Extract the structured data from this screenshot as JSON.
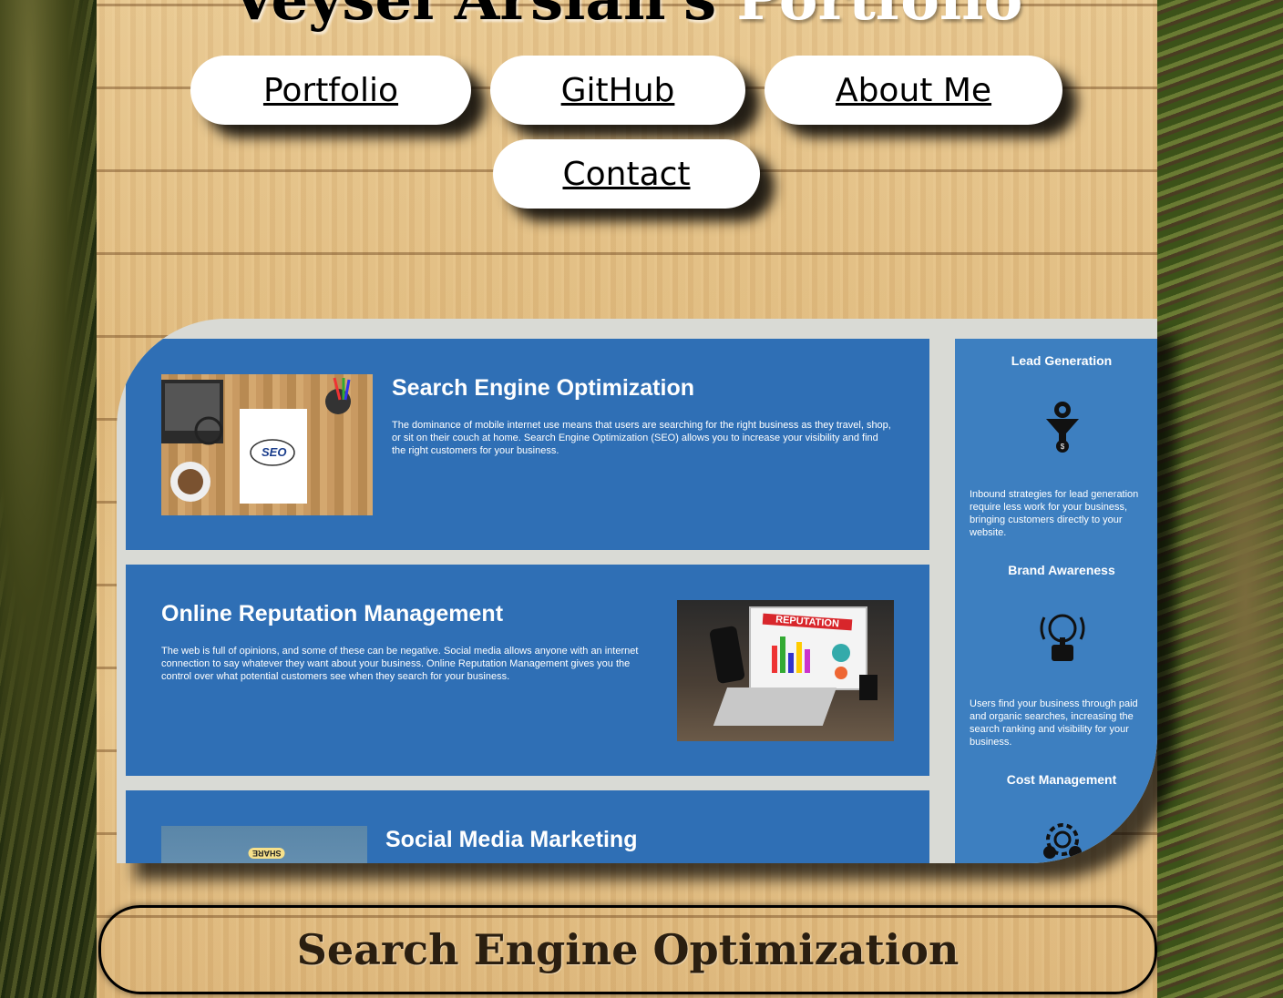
{
  "header": {
    "title_main": "Veysel Arslan's",
    "title_accent": "Portfolio"
  },
  "nav": {
    "portfolio": "Portfolio",
    "github": "GitHub",
    "about": "About Me",
    "contact": "Contact"
  },
  "preview": {
    "cards": [
      {
        "title": "Search Engine Optimization",
        "text": "The dominance of mobile internet use means that users are searching for the right business as they travel, shop, or sit on their couch at home. Search Engine Optimization (SEO) allows you to increase your visibility and find the right customers for your business.",
        "image_label": "SEO"
      },
      {
        "title": "Online Reputation Management",
        "text": "The web is full of opinions, and some of these can be negative. Social media allows anyone with an internet connection to say whatever they want about your business. Online Reputation Management gives you the control over what potential customers see when they search for your business.",
        "image_label": "REPUTATION"
      },
      {
        "title": "Social Media Marketing",
        "image_label": "SHARE"
      }
    ],
    "benefits": [
      {
        "title": "Lead Generation",
        "text": "Inbound strategies for lead generation require less work for your business, bringing customers directly to your website.",
        "icon": "funnel-gear-icon"
      },
      {
        "title": "Brand Awareness",
        "text": "Users find your business through paid and organic searches, increasing the search ranking and visibility for your business.",
        "icon": "lightbulb-person-icon"
      },
      {
        "title": "Cost Management",
        "icon": "gears-icon"
      }
    ]
  },
  "section": {
    "title": "Search Engine Optimization"
  },
  "colors": {
    "card_blue": "#2f6fb5",
    "side_blue": "#3d7fc0",
    "wood": "#e2bf84"
  }
}
